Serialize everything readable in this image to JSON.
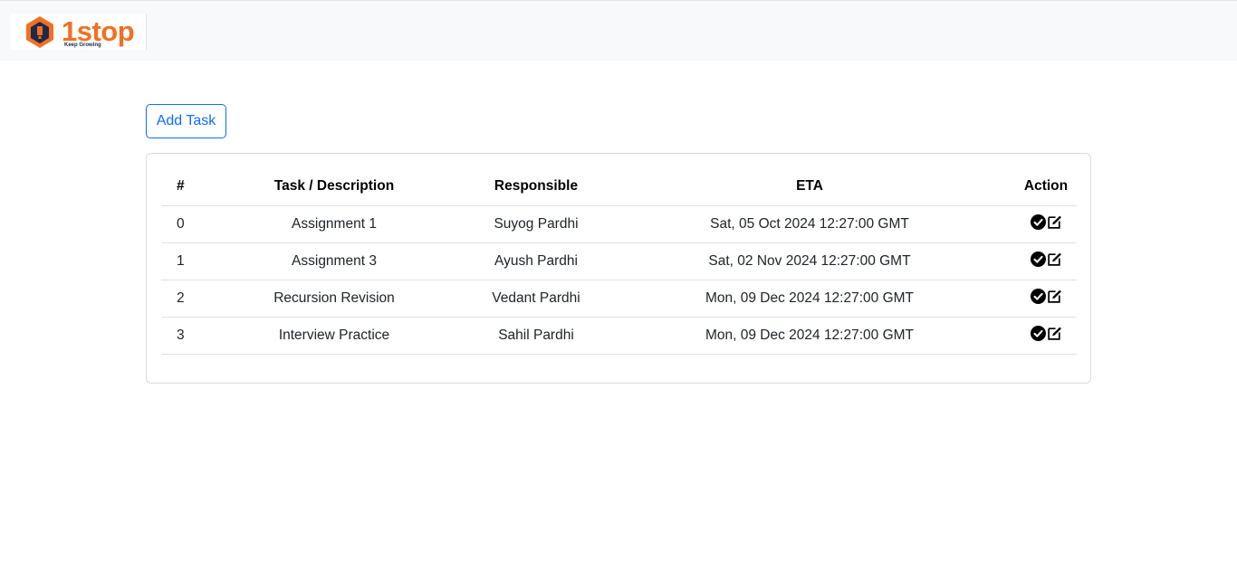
{
  "brand": {
    "name": "1stop",
    "tagline": "Keep Growing"
  },
  "toolbar": {
    "add_task_label": "Add Task"
  },
  "table": {
    "headers": [
      "#",
      "Task / Description",
      "Responsible",
      "ETA",
      "Action"
    ],
    "rows": [
      {
        "num": "0",
        "task": "Assignment 1",
        "responsible": "Suyog Pardhi",
        "eta": "Sat, 05 Oct 2024 12:27:00 GMT"
      },
      {
        "num": "1",
        "task": "Assignment 3",
        "responsible": "Ayush Pardhi",
        "eta": "Sat, 02 Nov 2024 12:27:00 GMT"
      },
      {
        "num": "2",
        "task": "Recursion Revision",
        "responsible": "Vedant Pardhi",
        "eta": "Mon, 09 Dec 2024 12:27:00 GMT"
      },
      {
        "num": "3",
        "task": "Interview Practice",
        "responsible": "Sahil Pardhi",
        "eta": "Mon, 09 Dec 2024 12:27:00 GMT"
      }
    ]
  },
  "icons": {
    "complete": "check-circle-icon",
    "edit": "edit-icon",
    "logo": "hexagon-logo-icon"
  },
  "colors": {
    "brand_orange": "#f36f21",
    "brand_navy": "#1c2a4a",
    "primary": "#0d6efd"
  }
}
